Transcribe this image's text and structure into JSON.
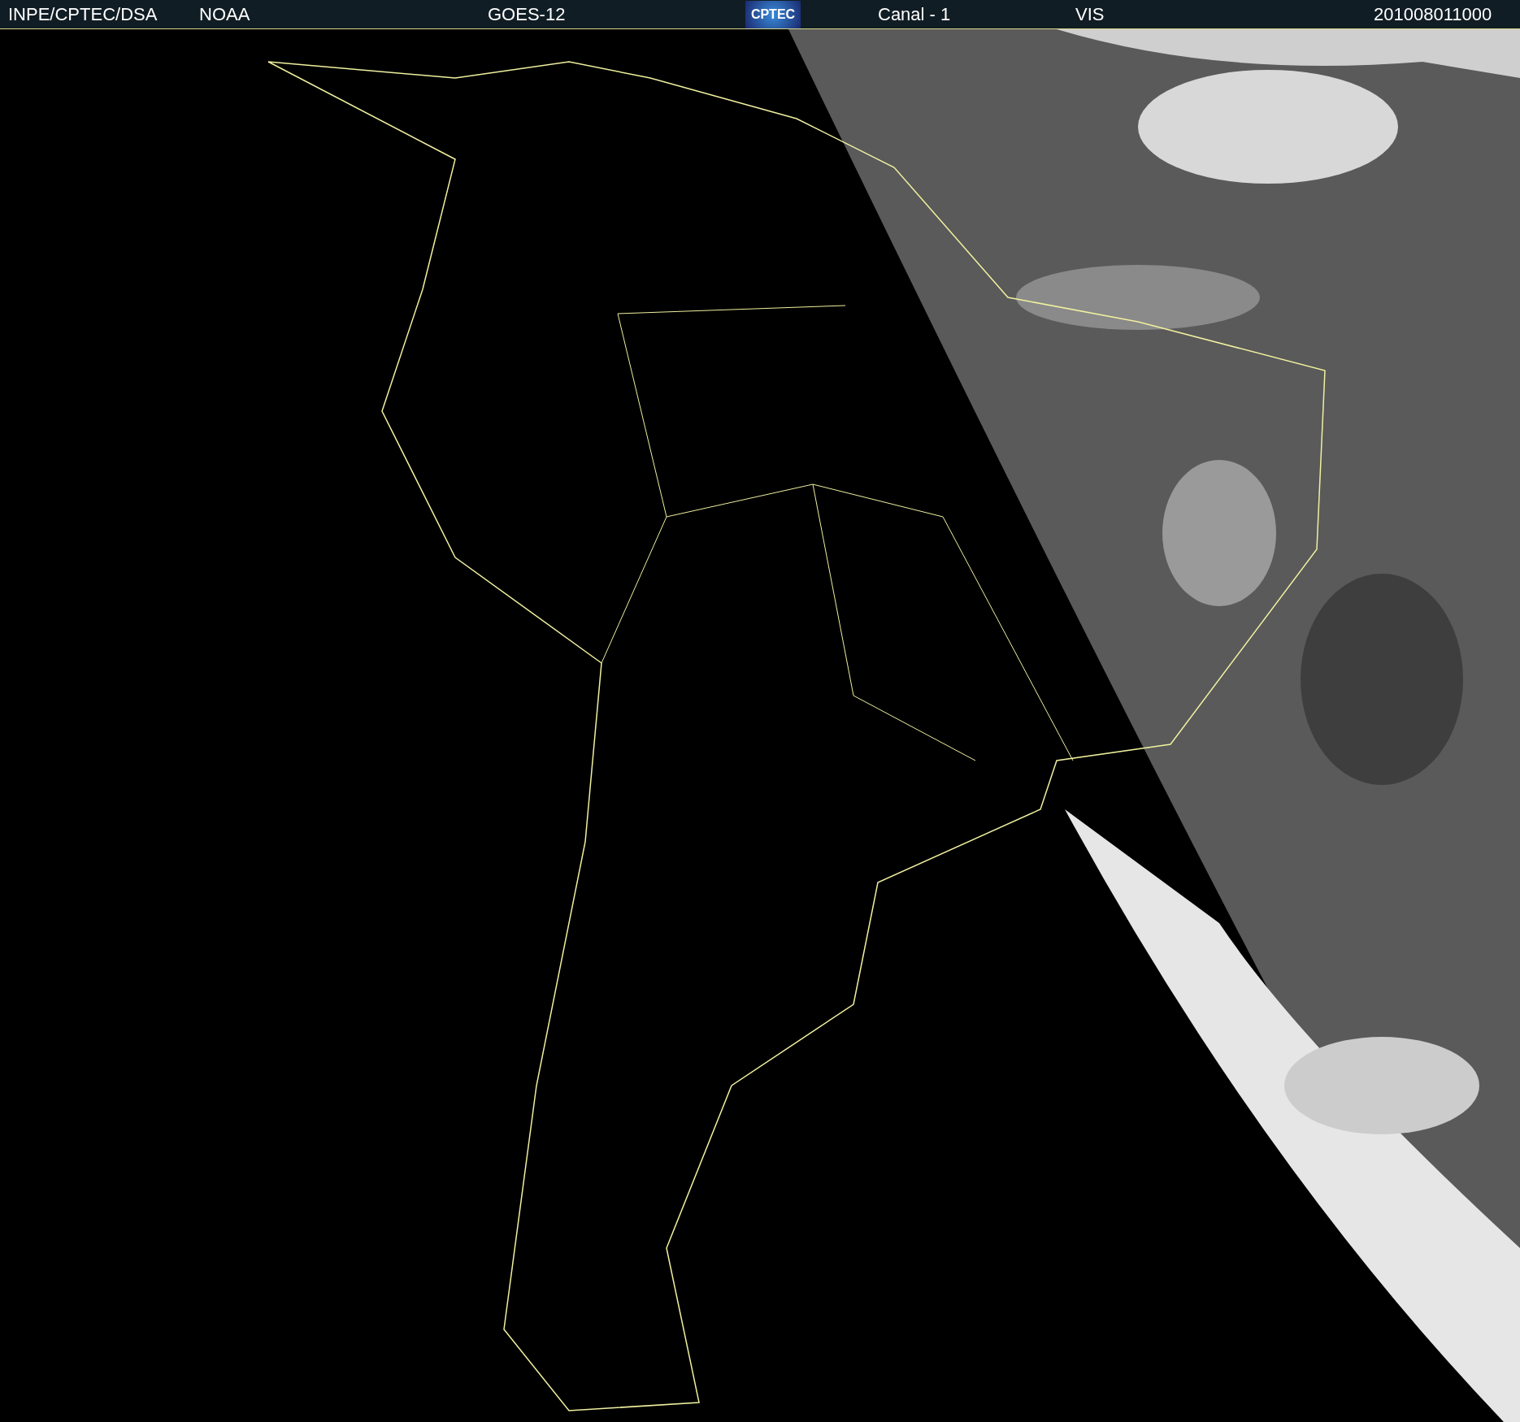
{
  "header": {
    "source": "INPE/CPTEC/DSA",
    "agency": "NOAA",
    "satellite": "GOES-12",
    "logo": "CPTEC",
    "channel": "Canal - 1",
    "band": "VIS",
    "timestamp": "201008011000"
  }
}
